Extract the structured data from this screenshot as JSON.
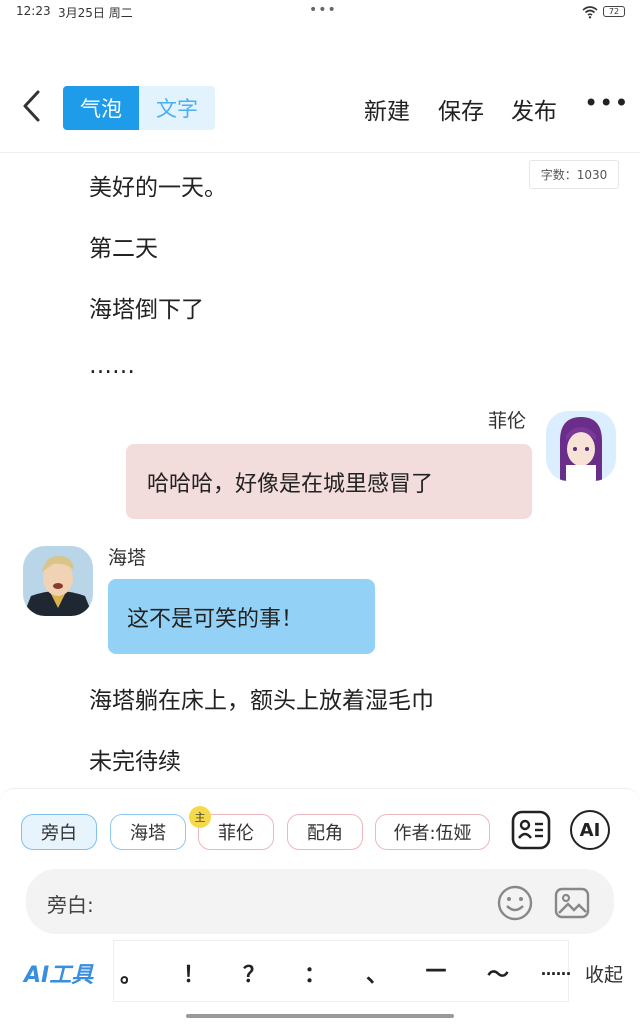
{
  "status": {
    "time": "12:23",
    "date": "3月25日 周二",
    "dots": "•••",
    "battery": "72"
  },
  "header": {
    "back_icon": "chevron-left-icon",
    "mode_bubble": "气泡",
    "mode_text": "文字",
    "new_label": "新建",
    "save_label": "保存",
    "publish_label": "发布",
    "more_label": "•••"
  },
  "word_count": "字数：1030",
  "story": {
    "lines_top": [
      "美好的一天。",
      "第二天",
      "海塔倒下了",
      "……"
    ],
    "messages": [
      {
        "speaker": "菲伦",
        "text": "哈哈哈，好像是在城里感冒了",
        "side": "right",
        "color": "#f3dcdc"
      },
      {
        "speaker": "海塔",
        "text": "这不是可笑的事！",
        "side": "left",
        "color": "#93d2f6"
      }
    ],
    "lines_bottom": [
      "海塔躺在床上，额头上放着湿毛巾",
      "未完待续"
    ]
  },
  "roles": {
    "chips": [
      "旁白",
      "海塔",
      "菲伦",
      "配角",
      "作者:伍娅"
    ],
    "main_badge": "主",
    "selected": "旁白"
  },
  "composer": {
    "label": "旁白:",
    "emoji_icon": "smiley-icon",
    "image_icon": "image-icon"
  },
  "toolbar": {
    "ai_tools": "AI工具",
    "punctuation": [
      "。",
      "！",
      "？",
      "：",
      "、",
      "—",
      "～",
      "……"
    ],
    "collapse": "收起",
    "ai_button": "AI"
  },
  "colors": {
    "accent": "#1e9be9",
    "accent_light": "#e3f3fd",
    "pink_bubble": "#f3dcdc",
    "blue_bubble": "#93d2f6"
  }
}
